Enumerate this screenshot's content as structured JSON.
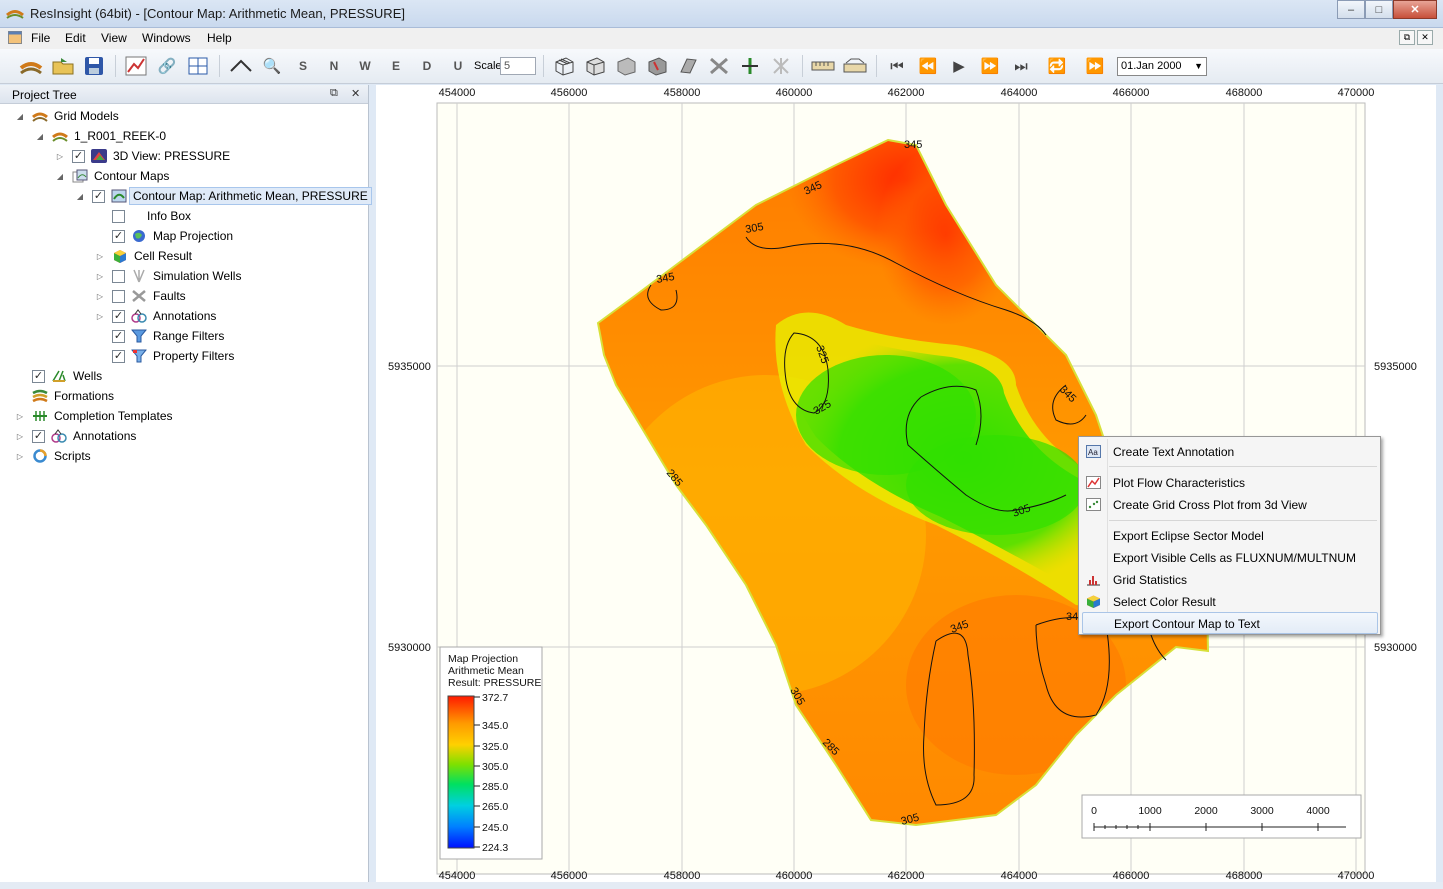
{
  "window": {
    "title": "ResInsight (64bit) - [Contour Map: Arithmetic Mean, PRESSURE]"
  },
  "menu": [
    "File",
    "Edit",
    "View",
    "Windows",
    "Help"
  ],
  "toolbar": {
    "scale_label": "Scale",
    "scale_value": "5",
    "date_value": "01.Jan 2000",
    "axis_buttons": [
      "S",
      "N",
      "W",
      "E",
      "D",
      "U"
    ]
  },
  "project_tree": {
    "title": "Project Tree",
    "items": [
      {
        "label": "Grid Models"
      },
      {
        "label": "1_R001_REEK-0"
      },
      {
        "label": "3D View: PRESSURE"
      },
      {
        "label": "Contour Maps"
      },
      {
        "label": "Contour Map: Arithmetic Mean, PRESSURE"
      },
      {
        "label": "Info Box"
      },
      {
        "label": "Map Projection"
      },
      {
        "label": "Cell Result"
      },
      {
        "label": "Simulation Wells"
      },
      {
        "label": "Faults"
      },
      {
        "label": "Annotations"
      },
      {
        "label": "Range Filters"
      },
      {
        "label": "Property Filters"
      },
      {
        "label": "Wells"
      },
      {
        "label": "Formations"
      },
      {
        "label": "Completion Templates"
      },
      {
        "label": "Annotations"
      },
      {
        "label": "Scripts"
      }
    ]
  },
  "map": {
    "x_ticks": [
      "454000",
      "456000",
      "458000",
      "460000",
      "462000",
      "464000",
      "466000",
      "468000",
      "470000"
    ],
    "y_ticks": [
      "5935000",
      "5930000"
    ],
    "contour_labels": [
      "345",
      "345",
      "305",
      "345",
      "325",
      "325",
      "345",
      "285",
      "305",
      "345",
      "34",
      "305",
      "285",
      "305"
    ],
    "legend": {
      "lines": [
        "Map Projection",
        "Arithmetic Mean",
        "Result: PRESSURE"
      ],
      "values": [
        "372.7",
        "345.0",
        "325.0",
        "305.0",
        "285.0",
        "265.0",
        "245.0",
        "224.3"
      ]
    },
    "scale_bar": [
      "0",
      "1000",
      "2000",
      "3000",
      "4000"
    ]
  },
  "context_menu": {
    "items": [
      {
        "label": "Create Text Annotation"
      },
      {
        "label": "Plot Flow Characteristics"
      },
      {
        "label": "Create Grid Cross Plot from 3d View"
      },
      {
        "label": "Export Eclipse Sector Model"
      },
      {
        "label": "Export Visible Cells as FLUXNUM/MULTNUM"
      },
      {
        "label": "Grid Statistics"
      },
      {
        "label": "Select Color Result"
      },
      {
        "label": "Export Contour Map to Text"
      }
    ]
  }
}
